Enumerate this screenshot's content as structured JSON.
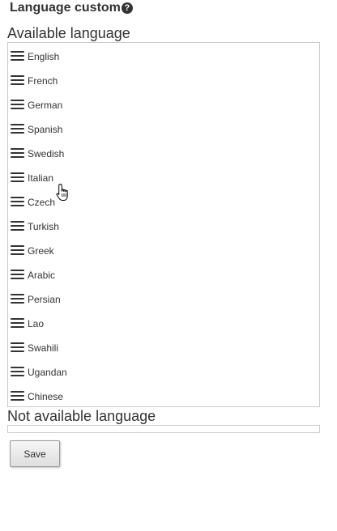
{
  "page": {
    "title": "Language custom",
    "help_glyph": "?"
  },
  "available": {
    "heading": "Available language",
    "items": [
      {
        "label": "English"
      },
      {
        "label": "French"
      },
      {
        "label": "German"
      },
      {
        "label": "Spanish"
      },
      {
        "label": "Swedish"
      },
      {
        "label": "Italian"
      },
      {
        "label": "Czech"
      },
      {
        "label": "Turkish"
      },
      {
        "label": "Greek"
      },
      {
        "label": "Arabic"
      },
      {
        "label": "Persian"
      },
      {
        "label": "Lao"
      },
      {
        "label": "Swahili"
      },
      {
        "label": "Ugandan"
      },
      {
        "label": "Chinese"
      }
    ]
  },
  "not_available": {
    "heading": "Not available language",
    "items": []
  },
  "actions": {
    "save_label": "Save"
  },
  "icons": {
    "help": "question-circle-icon",
    "drag_handle": "hamburger-drag-handle-icon",
    "cursor": "hand-pointer-cursor-icon"
  },
  "colors": {
    "text": "#333333",
    "border": "#cccccc",
    "button_border": "#999999",
    "background": "#ffffff"
  }
}
